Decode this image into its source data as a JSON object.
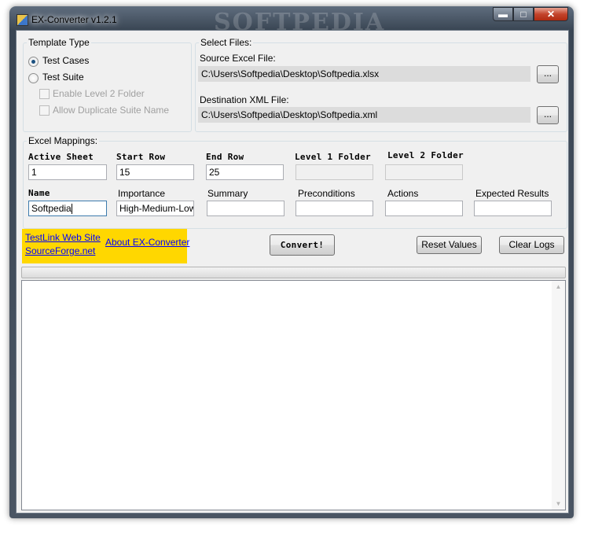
{
  "window": {
    "title": "EX-Converter v1.2.1",
    "watermark": "SOFTPEDIA",
    "controls": {
      "minimize": "▬",
      "maximize": "□",
      "close": "✕"
    }
  },
  "template_type": {
    "label": "Template Type",
    "options": [
      {
        "label": "Test Cases",
        "selected": true
      },
      {
        "label": "Test Suite",
        "selected": false
      }
    ],
    "checkboxes": [
      {
        "label": "Enable Level 2 Folder",
        "checked": false,
        "enabled": false
      },
      {
        "label": "Allow Duplicate Suite Name",
        "checked": false,
        "enabled": false
      }
    ]
  },
  "select_files": {
    "label": "Select Files:",
    "source_label": "Source Excel File:",
    "source_value": "C:\\Users\\Softpedia\\Desktop\\Softpedia.xlsx",
    "dest_label": "Destination XML File:",
    "dest_value": "C:\\Users\\Softpedia\\Desktop\\Softpedia.xml",
    "browse_label": "..."
  },
  "mappings": {
    "label": "Excel Mappings:",
    "row1": [
      {
        "label": "Active Sheet",
        "value": "1"
      },
      {
        "label": "Start Row",
        "value": "15"
      },
      {
        "label": "End Row",
        "value": "25"
      },
      {
        "label": "Level 1 Folder",
        "value": ""
      },
      {
        "label": "Level 2 Folder",
        "value": ""
      }
    ],
    "row2": [
      {
        "label": "Name",
        "value": "Softpedia"
      },
      {
        "label": "Importance",
        "value": "High-Medium-Low"
      },
      {
        "label": "Summary",
        "value": ""
      },
      {
        "label": "Preconditions",
        "value": ""
      },
      {
        "label": "Actions",
        "value": ""
      },
      {
        "label": "Expected Results",
        "value": ""
      }
    ]
  },
  "links": {
    "testlink": "TestLink Web Site",
    "sourceforge": "SourceForge.net",
    "about": "About EX-Converter"
  },
  "buttons": {
    "convert": "Convert!",
    "reset": "Reset Values",
    "clear_logs": "Clear Logs"
  },
  "progress": {
    "value": 0
  },
  "log": {
    "text": ""
  },
  "colors": {
    "link_panel": "#ffd700",
    "link": "#0000ff",
    "radio_dot": "#1c5180"
  }
}
